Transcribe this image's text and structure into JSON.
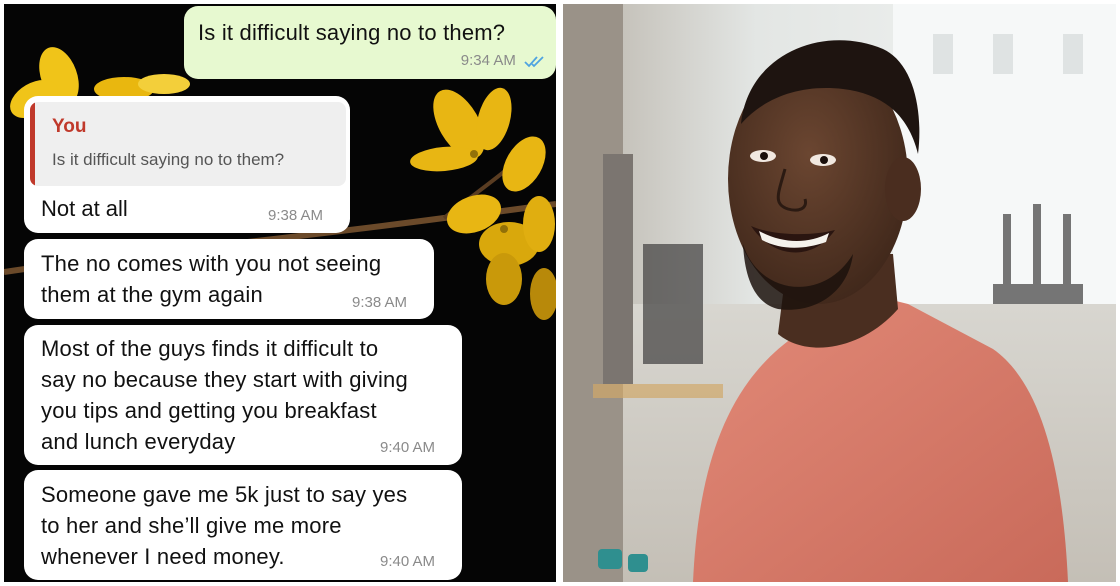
{
  "chat": {
    "messages": [
      {
        "direction": "outgoing",
        "text": "Is it difficult saying no to them?",
        "time": "9:34 AM",
        "status_icon": "double-check-icon"
      },
      {
        "direction": "incoming",
        "reply_to": {
          "name": "You",
          "text": "Is it difficult saying no to them?"
        },
        "text": "Not at all",
        "time": "9:38 AM"
      },
      {
        "direction": "incoming",
        "lines": [
          "The no comes with you not seeing",
          "them at the gym again"
        ],
        "time": "9:38 AM"
      },
      {
        "direction": "incoming",
        "lines": [
          "Most of the guys finds it difficult to",
          "say no because they start with giving",
          "you tips and getting you breakfast",
          "and lunch everyday"
        ],
        "time": "9:40 AM"
      },
      {
        "direction": "incoming",
        "lines": [
          "Someone gave me 5k just to say yes",
          "to her and she’ll give me more",
          "whenever I need money."
        ],
        "time": "9:40 AM"
      }
    ]
  },
  "colors": {
    "outgoing_bubble": "#e7f9d0",
    "incoming_bubble": "#ffffff",
    "reply_accent": "#c0392b",
    "read_ticks": "#4fa3e0"
  }
}
